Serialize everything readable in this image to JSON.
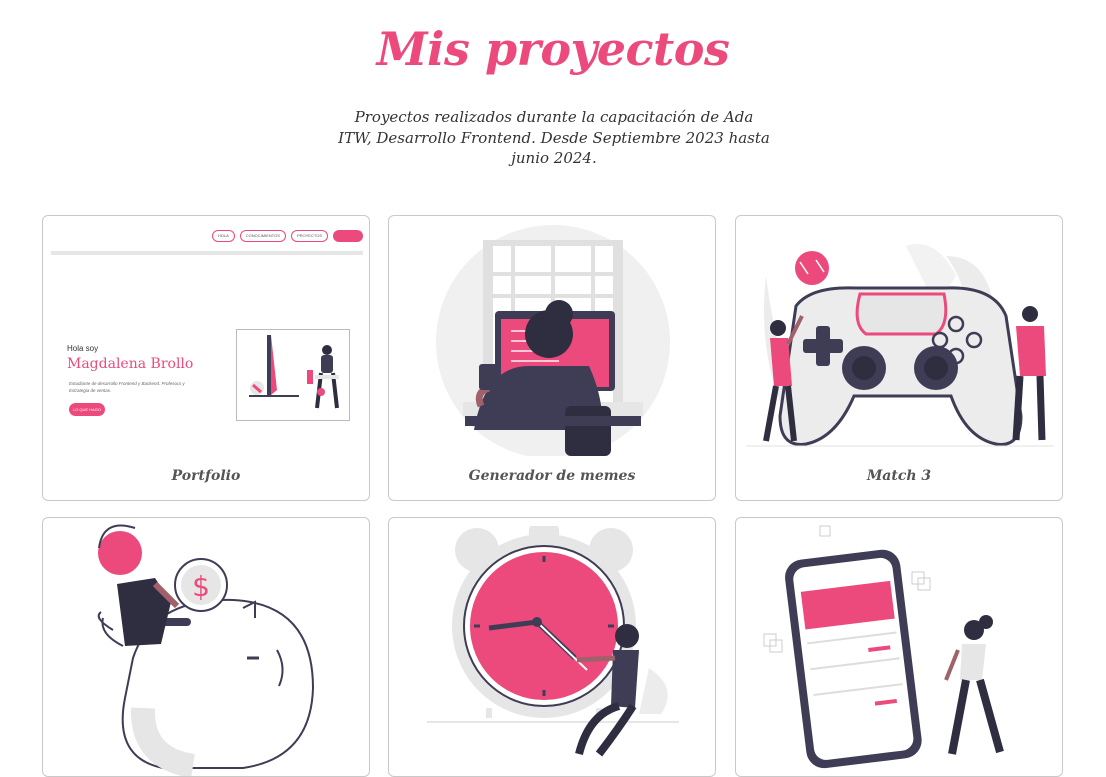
{
  "header": {
    "title": "Mis proyectos",
    "intro": "Proyectos realizados durante la capacitación de Ada ITW, Desarrollo Frontend. Desde Septiembre 2023 hasta junio 2024."
  },
  "colors": {
    "accent": "#ec4a7c",
    "dark": "#3f3d56",
    "light_gray": "#e6e6e6",
    "border": "#c9c9c9"
  },
  "projects": [
    {
      "label": "Portfolio",
      "preview": {
        "nav": [
          "HOLA",
          "CONOCIMIENTOS",
          "PROYECTOS",
          ""
        ],
        "greeting": "Hola soy",
        "name": "Magdalena Brollo",
        "description": "Estudiante de desarrollo Frontend y Backend. Profesora y Estrategia de ventas.",
        "button": "LO QUE HAGO"
      }
    },
    {
      "label": "Generador de memes",
      "icon": "person-at-computer-illustration"
    },
    {
      "label": "Match 3",
      "icon": "game-controller-illustration"
    },
    {
      "label": "",
      "icon": "piggy-bank-illustration"
    },
    {
      "label": "",
      "icon": "alarm-clock-illustration"
    },
    {
      "label": "",
      "icon": "mobile-phone-illustration"
    }
  ]
}
